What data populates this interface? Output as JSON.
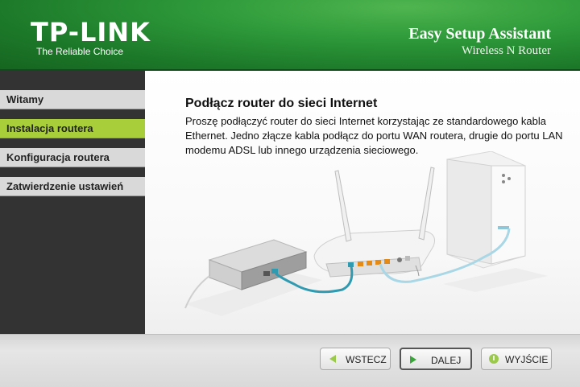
{
  "header": {
    "brand": "TP-LINK",
    "tagline": "The Reliable Choice",
    "title": "Easy Setup Assistant",
    "subtitle": "Wireless N Router"
  },
  "sidebar": {
    "items": [
      {
        "label": "Witamy"
      },
      {
        "label": "Instalacja routera"
      },
      {
        "label": "Konfiguracja routera"
      },
      {
        "label": "Zatwierdzenie ustawień"
      }
    ],
    "active_index": 1
  },
  "main": {
    "heading": "Podłącz router do sieci Internet",
    "description": "Proszę podłączyć router do sieci Internet korzystając ze standardowego kabla Ethernet. Jedno złącze kabla podłącz do portu WAN routera, drugie do portu LAN modemu ADSL lub innego urządzenia sieciowego."
  },
  "footer": {
    "back_label": "WSTECZ",
    "next_label": "DALEJ",
    "exit_label": "WYJŚCIE"
  },
  "colors": {
    "header_green": "#2e9a3a",
    "active_item": "#a8cf3a",
    "cable_wan": "#2f9ab0",
    "cable_lan": "#a9d7e6"
  }
}
